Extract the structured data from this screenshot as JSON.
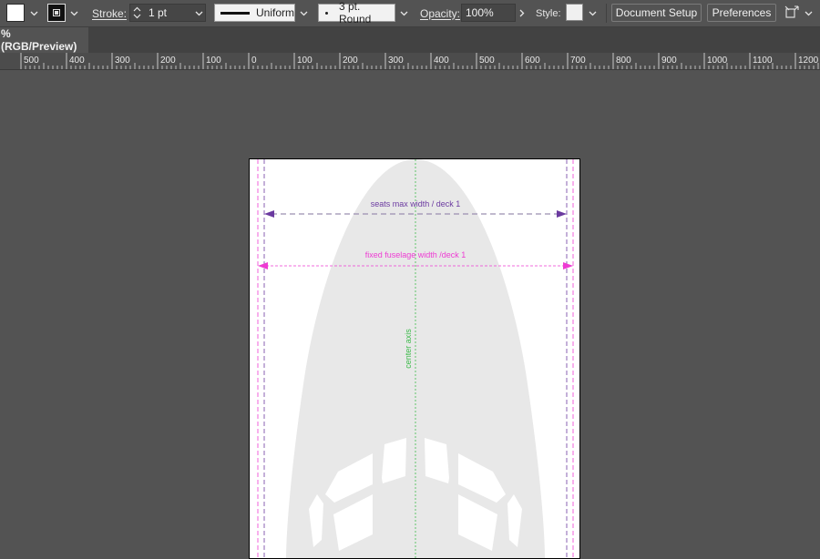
{
  "control_bar": {
    "stroke_label": "Stroke:",
    "stroke_weight": "1 pt",
    "profile_label": "Uniform",
    "brush_label": "3 pt. Round",
    "opacity_label": "Opacity:",
    "opacity_value": "100%",
    "style_label": "Style:",
    "document_setup": "Document Setup",
    "preferences": "Preferences"
  },
  "document_tab": {
    "label": "% (RGB/Preview)"
  },
  "ruler": {
    "labels": [
      "500",
      "400",
      "300",
      "200",
      "100",
      "0",
      "100",
      "200",
      "300",
      "400",
      "500",
      "600",
      "700",
      "800",
      "900",
      "1000",
      "1100",
      "1200"
    ]
  },
  "artboard": {
    "annotations": {
      "seats_width": "seats max width / deck 1",
      "fuselage_width": "fixed fuselage width  /deck 1",
      "center_axis": "center axis"
    },
    "colors": {
      "seats_line": "#6b3aa0",
      "fuselage_line": "#ee3bd3",
      "center_axis": "#3cba4a",
      "fuselage_fill": "#e8e8e8"
    }
  }
}
